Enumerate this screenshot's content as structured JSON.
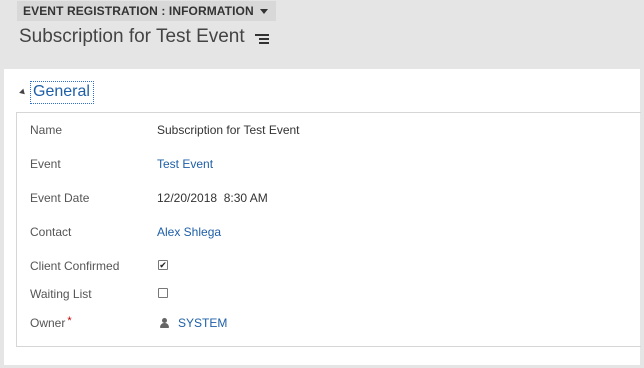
{
  "header": {
    "form_selector_label": "EVENT REGISTRATION : INFORMATION",
    "record_title": "Subscription for Test Event"
  },
  "section": {
    "title": "General"
  },
  "fields": {
    "name": {
      "label": "Name",
      "value": "Subscription for Test Event"
    },
    "event": {
      "label": "Event",
      "value": "Test Event"
    },
    "event_date": {
      "label": "Event Date",
      "value": "12/20/2018  8:30 AM"
    },
    "contact": {
      "label": "Contact",
      "value": "Alex Shlega"
    },
    "client_confirmed": {
      "label": "Client Confirmed",
      "checked": true,
      "mark": "✔"
    },
    "waiting_list": {
      "label": "Waiting List",
      "checked": false,
      "mark": ""
    },
    "owner": {
      "label": "Owner",
      "required_mark": "*",
      "value": "SYSTEM"
    }
  },
  "colors": {
    "link": "#1e5fa8",
    "required": "#c00000",
    "header_bg": "#e5e5e5"
  }
}
